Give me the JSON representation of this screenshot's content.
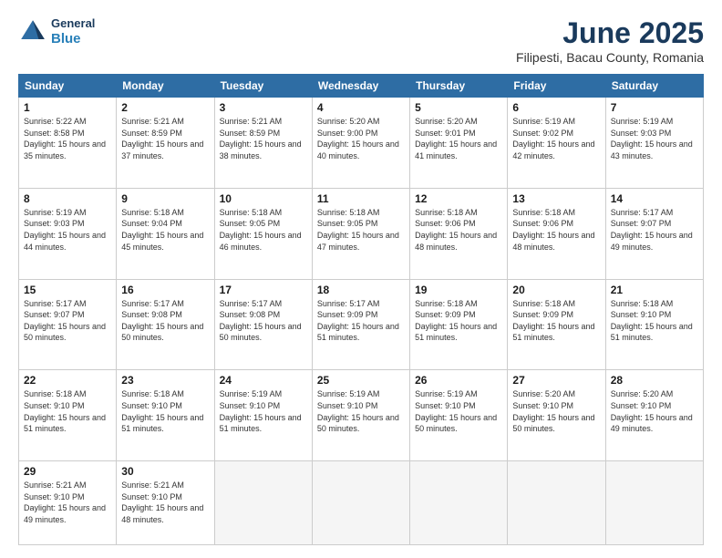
{
  "logo": {
    "general": "General",
    "blue": "Blue"
  },
  "title": "June 2025",
  "location": "Filipesti, Bacau County, Romania",
  "headers": [
    "Sunday",
    "Monday",
    "Tuesday",
    "Wednesday",
    "Thursday",
    "Friday",
    "Saturday"
  ],
  "weeks": [
    [
      {
        "day": "1",
        "sunrise": "Sunrise: 5:22 AM",
        "sunset": "Sunset: 8:58 PM",
        "daylight": "Daylight: 15 hours and 35 minutes."
      },
      {
        "day": "2",
        "sunrise": "Sunrise: 5:21 AM",
        "sunset": "Sunset: 8:59 PM",
        "daylight": "Daylight: 15 hours and 37 minutes."
      },
      {
        "day": "3",
        "sunrise": "Sunrise: 5:21 AM",
        "sunset": "Sunset: 8:59 PM",
        "daylight": "Daylight: 15 hours and 38 minutes."
      },
      {
        "day": "4",
        "sunrise": "Sunrise: 5:20 AM",
        "sunset": "Sunset: 9:00 PM",
        "daylight": "Daylight: 15 hours and 40 minutes."
      },
      {
        "day": "5",
        "sunrise": "Sunrise: 5:20 AM",
        "sunset": "Sunset: 9:01 PM",
        "daylight": "Daylight: 15 hours and 41 minutes."
      },
      {
        "day": "6",
        "sunrise": "Sunrise: 5:19 AM",
        "sunset": "Sunset: 9:02 PM",
        "daylight": "Daylight: 15 hours and 42 minutes."
      },
      {
        "day": "7",
        "sunrise": "Sunrise: 5:19 AM",
        "sunset": "Sunset: 9:03 PM",
        "daylight": "Daylight: 15 hours and 43 minutes."
      }
    ],
    [
      {
        "day": "8",
        "sunrise": "Sunrise: 5:19 AM",
        "sunset": "Sunset: 9:03 PM",
        "daylight": "Daylight: 15 hours and 44 minutes."
      },
      {
        "day": "9",
        "sunrise": "Sunrise: 5:18 AM",
        "sunset": "Sunset: 9:04 PM",
        "daylight": "Daylight: 15 hours and 45 minutes."
      },
      {
        "day": "10",
        "sunrise": "Sunrise: 5:18 AM",
        "sunset": "Sunset: 9:05 PM",
        "daylight": "Daylight: 15 hours and 46 minutes."
      },
      {
        "day": "11",
        "sunrise": "Sunrise: 5:18 AM",
        "sunset": "Sunset: 9:05 PM",
        "daylight": "Daylight: 15 hours and 47 minutes."
      },
      {
        "day": "12",
        "sunrise": "Sunrise: 5:18 AM",
        "sunset": "Sunset: 9:06 PM",
        "daylight": "Daylight: 15 hours and 48 minutes."
      },
      {
        "day": "13",
        "sunrise": "Sunrise: 5:18 AM",
        "sunset": "Sunset: 9:06 PM",
        "daylight": "Daylight: 15 hours and 48 minutes."
      },
      {
        "day": "14",
        "sunrise": "Sunrise: 5:17 AM",
        "sunset": "Sunset: 9:07 PM",
        "daylight": "Daylight: 15 hours and 49 minutes."
      }
    ],
    [
      {
        "day": "15",
        "sunrise": "Sunrise: 5:17 AM",
        "sunset": "Sunset: 9:07 PM",
        "daylight": "Daylight: 15 hours and 50 minutes."
      },
      {
        "day": "16",
        "sunrise": "Sunrise: 5:17 AM",
        "sunset": "Sunset: 9:08 PM",
        "daylight": "Daylight: 15 hours and 50 minutes."
      },
      {
        "day": "17",
        "sunrise": "Sunrise: 5:17 AM",
        "sunset": "Sunset: 9:08 PM",
        "daylight": "Daylight: 15 hours and 50 minutes."
      },
      {
        "day": "18",
        "sunrise": "Sunrise: 5:17 AM",
        "sunset": "Sunset: 9:09 PM",
        "daylight": "Daylight: 15 hours and 51 minutes."
      },
      {
        "day": "19",
        "sunrise": "Sunrise: 5:18 AM",
        "sunset": "Sunset: 9:09 PM",
        "daylight": "Daylight: 15 hours and 51 minutes."
      },
      {
        "day": "20",
        "sunrise": "Sunrise: 5:18 AM",
        "sunset": "Sunset: 9:09 PM",
        "daylight": "Daylight: 15 hours and 51 minutes."
      },
      {
        "day": "21",
        "sunrise": "Sunrise: 5:18 AM",
        "sunset": "Sunset: 9:10 PM",
        "daylight": "Daylight: 15 hours and 51 minutes."
      }
    ],
    [
      {
        "day": "22",
        "sunrise": "Sunrise: 5:18 AM",
        "sunset": "Sunset: 9:10 PM",
        "daylight": "Daylight: 15 hours and 51 minutes."
      },
      {
        "day": "23",
        "sunrise": "Sunrise: 5:18 AM",
        "sunset": "Sunset: 9:10 PM",
        "daylight": "Daylight: 15 hours and 51 minutes."
      },
      {
        "day": "24",
        "sunrise": "Sunrise: 5:19 AM",
        "sunset": "Sunset: 9:10 PM",
        "daylight": "Daylight: 15 hours and 51 minutes."
      },
      {
        "day": "25",
        "sunrise": "Sunrise: 5:19 AM",
        "sunset": "Sunset: 9:10 PM",
        "daylight": "Daylight: 15 hours and 50 minutes."
      },
      {
        "day": "26",
        "sunrise": "Sunrise: 5:19 AM",
        "sunset": "Sunset: 9:10 PM",
        "daylight": "Daylight: 15 hours and 50 minutes."
      },
      {
        "day": "27",
        "sunrise": "Sunrise: 5:20 AM",
        "sunset": "Sunset: 9:10 PM",
        "daylight": "Daylight: 15 hours and 50 minutes."
      },
      {
        "day": "28",
        "sunrise": "Sunrise: 5:20 AM",
        "sunset": "Sunset: 9:10 PM",
        "daylight": "Daylight: 15 hours and 49 minutes."
      }
    ],
    [
      {
        "day": "29",
        "sunrise": "Sunrise: 5:21 AM",
        "sunset": "Sunset: 9:10 PM",
        "daylight": "Daylight: 15 hours and 49 minutes."
      },
      {
        "day": "30",
        "sunrise": "Sunrise: 5:21 AM",
        "sunset": "Sunset: 9:10 PM",
        "daylight": "Daylight: 15 hours and 48 minutes."
      },
      null,
      null,
      null,
      null,
      null
    ]
  ]
}
